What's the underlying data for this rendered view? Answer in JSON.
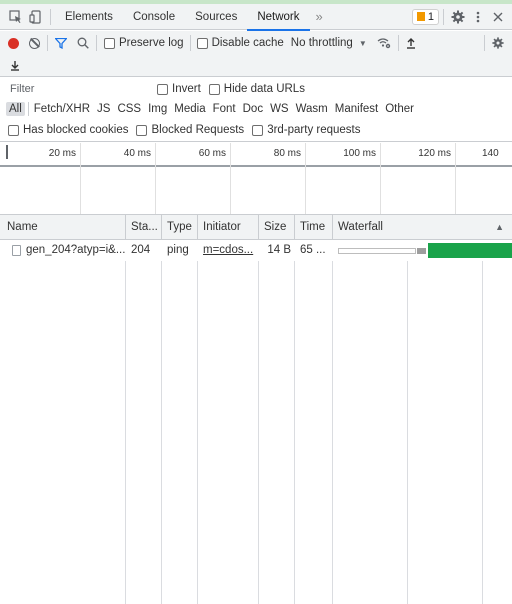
{
  "tabs": [
    {
      "label": "Elements"
    },
    {
      "label": "Console"
    },
    {
      "label": "Sources"
    },
    {
      "label": "Network",
      "active": true
    }
  ],
  "more_tabs_label": "»",
  "issues_count": "1",
  "toolbar": {
    "preserve_log": "Preserve log",
    "disable_cache": "Disable cache",
    "throttling": "No throttling"
  },
  "filter": {
    "placeholder": "Filter",
    "invert": "Invert",
    "hide_data_urls": "Hide data URLs",
    "types": [
      "All",
      "Fetch/XHR",
      "JS",
      "CSS",
      "Img",
      "Media",
      "Font",
      "Doc",
      "WS",
      "Wasm",
      "Manifest",
      "Other"
    ],
    "active_type": "All",
    "has_blocked_cookies": "Has blocked cookies",
    "blocked_requests": "Blocked Requests",
    "third_party": "3rd-party requests"
  },
  "overview": {
    "ticks": [
      "20 ms",
      "40 ms",
      "60 ms",
      "80 ms",
      "100 ms",
      "120 ms",
      "140"
    ]
  },
  "table": {
    "columns": [
      "Name",
      "Sta...",
      "Type",
      "Initiator",
      "Size",
      "Time",
      "Waterfall"
    ],
    "sort_indicator": "▲",
    "rows": [
      {
        "name": "gen_204?atyp=i&...",
        "status": "204",
        "type": "ping",
        "initiator": "m=cdos...",
        "size": "14 B",
        "time": "65 ..."
      }
    ]
  },
  "colors": {
    "record": "#d93025",
    "filter_active": "#1a73e8",
    "waterfall_download": "#1aa34a",
    "issues_badge": "#f29900"
  },
  "icons": [
    "inspect-element-icon",
    "device-toolbar-icon",
    "settings-gear-icon",
    "kebab-menu-icon",
    "close-icon",
    "record-icon",
    "clear-icon",
    "filter-icon",
    "search-icon",
    "wifi-settings-icon",
    "upload-icon",
    "download-icon",
    "network-settings-gear-icon"
  ]
}
